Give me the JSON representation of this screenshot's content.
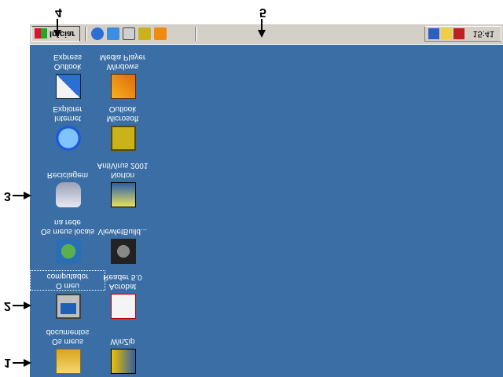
{
  "taskbar": {
    "start_label": "Iniciar",
    "clock": "15:41",
    "quick_launch": [
      "internet-explorer-icon",
      "outlook-express-icon",
      "desktop-icon",
      "outlook-icon",
      "media-player-icon"
    ],
    "tray_icons": [
      "network-icon",
      "volume-icon",
      "antivirus-icon"
    ]
  },
  "desktop": {
    "icons": [
      {
        "label": "Os meus\ndocumentos",
        "icon": "folder-documents-icon"
      },
      {
        "label": "WinZip",
        "icon": "winzip-icon"
      },
      {
        "label": "O meu\ncomputador",
        "icon": "my-computer-icon"
      },
      {
        "label": "Acrobat\nReader 5.0",
        "icon": "acrobat-icon"
      },
      {
        "label": "Os meus locais\nna rede",
        "icon": "network-places-icon"
      },
      {
        "label": "ViewletBuild...",
        "icon": "viewletbuilder-icon"
      },
      {
        "label": "Reciclagem",
        "icon": "recycle-bin-icon"
      },
      {
        "label": "Norton\nAntiVirus 2001",
        "icon": "norton-icon"
      },
      {
        "label": "Internet\nExplorer",
        "icon": "ie-icon"
      },
      {
        "label": "Microsoft\nOutlook",
        "icon": "outlook-icon"
      },
      {
        "label": "Outlook\nExpress",
        "icon": "outlook-express-icon"
      },
      {
        "label": "Windows\nMedia Player",
        "icon": "media-player-icon"
      }
    ]
  },
  "callouts": [
    "1",
    "2",
    "3",
    "4",
    "5"
  ],
  "colors": {
    "desktop": "#3a6ea5",
    "taskbar": "#d4d0c8"
  }
}
